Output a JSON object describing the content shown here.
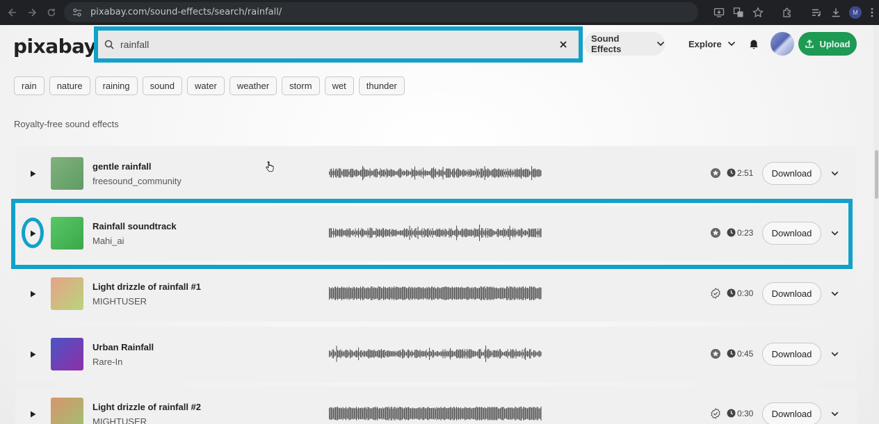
{
  "browser": {
    "url": "pixabay.com/sound-effects/search/rainfall/",
    "profile_initial": "M"
  },
  "header": {
    "logo": "pixabay",
    "search_value": "rainfall",
    "nav_sound_effects": "Sound Effects",
    "nav_explore": "Explore",
    "upload_label": "Upload"
  },
  "tags": [
    "rain",
    "nature",
    "raining",
    "sound",
    "water",
    "weather",
    "storm",
    "wet",
    "thunder"
  ],
  "section_title": "Royalty-free sound effects",
  "download_label": "Download",
  "results": [
    {
      "title": "gentle rainfall",
      "artist": "freesound_community",
      "duration": "2:51",
      "badge": "star-badge-icon",
      "thumb_from": "#82b17e",
      "thumb_to": "#5f9c64"
    },
    {
      "title": "Rainfall soundtrack",
      "artist": "Mahi_ai",
      "duration": "0:23",
      "badge": "star-badge-icon",
      "thumb_from": "#59c765",
      "thumb_to": "#3aa84b"
    },
    {
      "title": "Light drizzle of rainfall #1",
      "artist": "MIGHTUSER",
      "duration": "0:30",
      "badge": "verified-badge-icon",
      "thumb_from": "#e6a28a",
      "thumb_to": "#b8d57a"
    },
    {
      "title": "Urban Rainfall",
      "artist": "Rare-In",
      "duration": "0:45",
      "badge": "star-badge-icon",
      "thumb_from": "#4a55c4",
      "thumb_to": "#8f2fa8"
    },
    {
      "title": "Light drizzle of rainfall #2",
      "artist": "MIGHTUSER",
      "duration": "0:30",
      "badge": "verified-badge-icon",
      "thumb_from": "#d8946e",
      "thumb_to": "#9fc070"
    }
  ],
  "colors": {
    "highlight": "#11a1c9",
    "upload_green": "#1d9a53"
  }
}
